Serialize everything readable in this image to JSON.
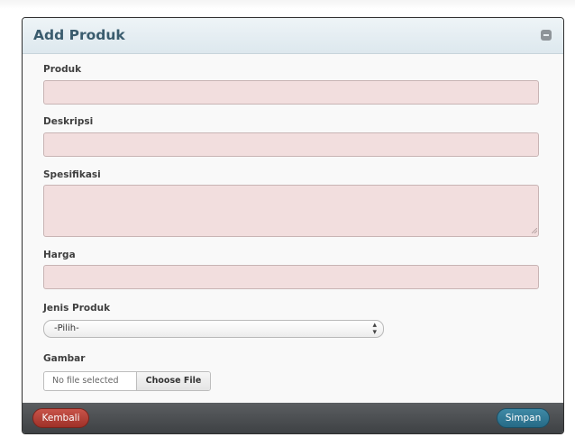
{
  "modal": {
    "title": "Add Produk",
    "collapse_icon": "minimize-icon"
  },
  "form": {
    "produk": {
      "label": "Produk",
      "value": "",
      "placeholder": ""
    },
    "deskripsi": {
      "label": "Deskripsi",
      "value": "",
      "placeholder": ""
    },
    "spesifikasi": {
      "label": "Spesifikasi",
      "value": ""
    },
    "harga": {
      "label": "Harga",
      "value": "",
      "placeholder": ""
    },
    "jenis_produk": {
      "label": "Jenis Produk",
      "selected": "-Pilih-"
    },
    "gambar": {
      "label": "Gambar",
      "file_status": "No file selected",
      "button_label": "Choose File"
    }
  },
  "footer": {
    "back_label": "Kembali",
    "save_label": "Simpan"
  },
  "colors": {
    "header_title": "#3a5c6e",
    "input_error_bg": "#f2dede",
    "back_button": "#b3433a",
    "save_button": "#337d99",
    "footer_bg": "#4a4d50"
  }
}
